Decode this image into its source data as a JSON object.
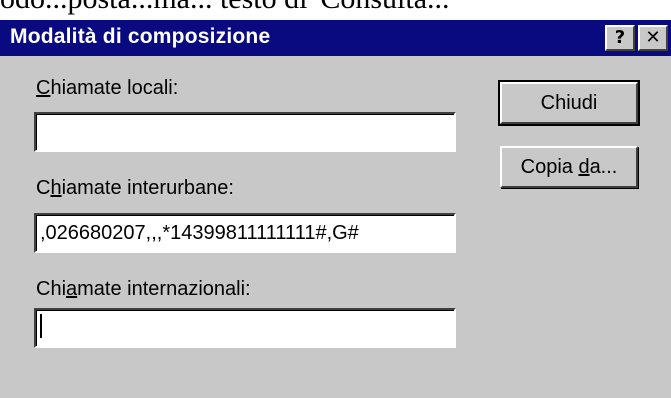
{
  "background_text": "odo...posta...ma... testo di 'Consulta...",
  "window": {
    "title": "Modalità di composizione",
    "help_glyph": "?",
    "close_glyph": "✕"
  },
  "fields": {
    "local": {
      "label_prefix": "",
      "label_mnemonic": "C",
      "label_rest": "hiamate locali:",
      "value": ""
    },
    "longdistance": {
      "label_prefix": "C",
      "label_mnemonic": "h",
      "label_rest": "iamate interurbane:",
      "value": ",026680207,,,*14399811111111#,G#"
    },
    "international": {
      "label_prefix": "Chi",
      "label_mnemonic": "a",
      "label_rest": "mate internazionali:",
      "value": ""
    }
  },
  "buttons": {
    "close_label": "Chiudi",
    "copy_prefix": "Copia ",
    "copy_mnemonic": "d",
    "copy_rest": "a..."
  },
  "colors": {
    "titlebar": "#0a0a80",
    "face": "#c8c8c8"
  }
}
